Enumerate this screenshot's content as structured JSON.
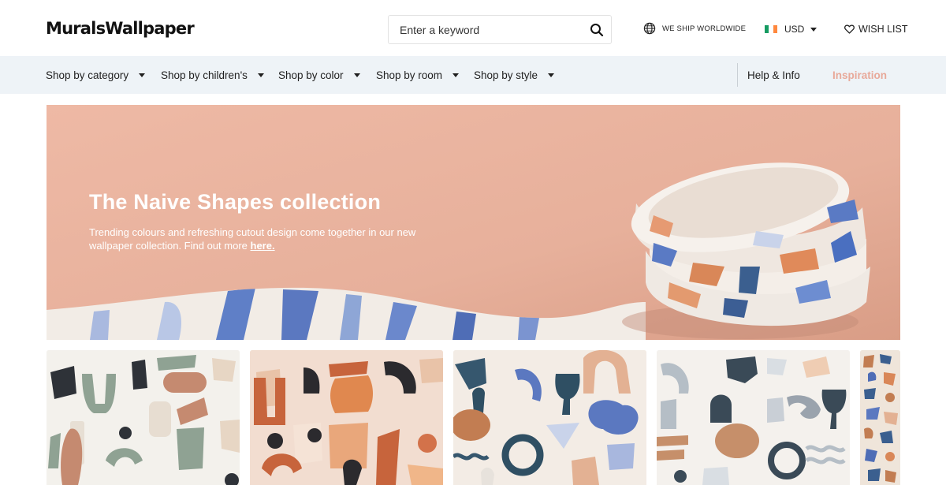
{
  "header": {
    "logo": "MuralsWallpaper",
    "search": {
      "placeholder": "Enter a keyword"
    },
    "shipping": "WE SHIP WORLDWIDE",
    "currency": {
      "selected": "USD",
      "flag_colors": [
        "#169b62",
        "#ffffff",
        "#ff883e"
      ]
    },
    "wishlist": "WISH LIST"
  },
  "nav": {
    "items": [
      {
        "label": "Shop by category"
      },
      {
        "label": "Shop by children's"
      },
      {
        "label": "Shop by color"
      },
      {
        "label": "Shop by room"
      },
      {
        "label": "Shop by style"
      }
    ],
    "help": "Help & Info",
    "inspiration": "Inspiration"
  },
  "hero": {
    "title": "The Naive Shapes collection",
    "subtitle": "Trending colours and refreshing cutout design come together in our new wallpaper collection. Find out more",
    "link": "here."
  },
  "colors": {
    "accent": "#e8a99a",
    "nav_background": "#eef3f7",
    "hero_background": "#eab49f"
  },
  "icons": [
    "search-icon",
    "globe-icon",
    "heart-icon",
    "chevron-down-icon"
  ]
}
